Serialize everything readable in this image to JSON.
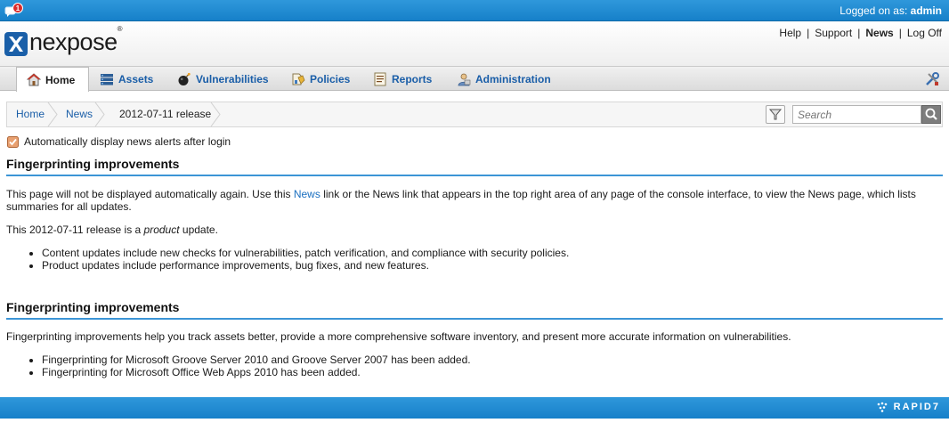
{
  "topbar": {
    "notification_count": "1",
    "logged_prefix": "Logged on as: ",
    "user": "admin"
  },
  "brand": {
    "logo_text": "nexpose",
    "logo_reg": "®"
  },
  "toplinks": [
    {
      "label": "Help"
    },
    {
      "label": "Support"
    },
    {
      "label": "News"
    },
    {
      "label": "Log Off"
    }
  ],
  "nav": {
    "tabs": [
      {
        "label": "Home",
        "icon": "home-icon"
      },
      {
        "label": "Assets",
        "icon": "assets-icon"
      },
      {
        "label": "Vulnerabilities",
        "icon": "bomb-icon"
      },
      {
        "label": "Policies",
        "icon": "policies-icon"
      },
      {
        "label": "Reports",
        "icon": "reports-icon"
      },
      {
        "label": "Administration",
        "icon": "admin-icon"
      }
    ]
  },
  "breadcrumb": [
    {
      "label": "Home"
    },
    {
      "label": "News"
    },
    {
      "label": "2012-07-11 release"
    }
  ],
  "search": {
    "placeholder": "Search"
  },
  "auto_display": {
    "label": "Automatically display news alerts after login",
    "checked": true
  },
  "content": {
    "heading1": "Fingerprinting improvements",
    "intro_before_link": "This page will not be displayed automatically again. Use this ",
    "intro_link": "News",
    "intro_after_link": " link or the News link that appears in the top right area of any page of the console interface, to view the News page, which lists summaries for all updates.",
    "release_before": "This 2012-07-11 release is a ",
    "release_em": "product",
    "release_after": " update.",
    "bullets1": [
      "Content updates include new checks for vulnerabilities, patch verification, and compliance with security policies.",
      "Product updates include performance improvements, bug fixes, and new features."
    ],
    "heading2": "Fingerprinting improvements",
    "paragraph2": "Fingerprinting improvements help you track assets better, provide a more comprehensive software inventory, and present more accurate information on vulnerabilities.",
    "bullets2": [
      "Fingerprinting for Microsoft Groove Server 2010 and Groove Server 2007 has been added.",
      "Fingerprinting for Microsoft Office Web Apps 2010 has been added."
    ]
  },
  "footer": {
    "brand": "RAPID7"
  }
}
